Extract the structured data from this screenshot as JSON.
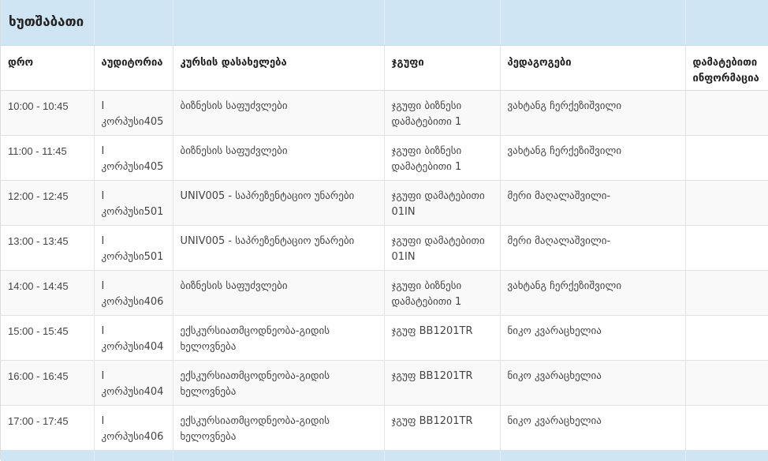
{
  "day_title": "ხუთშაბათი",
  "headers": {
    "time": "დრო",
    "room": "აუდიტორია",
    "course": "კურსის დასახელება",
    "group": "ჯგუფი",
    "teachers": "პედაგოგები",
    "extra": "დამატებითი ინფორმაცია"
  },
  "rows": [
    {
      "time": "10:00 - 10:45",
      "room_line1": "I",
      "room_line2": "კორპუსი405",
      "course": "ბიზნესის საფუძვლები",
      "group": "ჯგუფი ბიზნესი დამატებითი 1",
      "teacher": "ვახტანგ ჩერქეზიშვილი",
      "extra": ""
    },
    {
      "time": "11:00 - 11:45",
      "room_line1": "I",
      "room_line2": "კორპუსი405",
      "course": "ბიზნესის საფუძვლები",
      "group": "ჯგუფი ბიზნესი დამატებითი 1",
      "teacher": "ვახტანგ ჩერქეზიშვილი",
      "extra": ""
    },
    {
      "time": "12:00 - 12:45",
      "room_line1": "I",
      "room_line2": "კორპუსი501",
      "course": "UNIV005 - საპრეზენტაციო უნარები",
      "group": "ჯგუფი დამატებითი 01IN",
      "teacher": "მერი მაღალაშვილი-",
      "extra": ""
    },
    {
      "time": "13:00 - 13:45",
      "room_line1": "I",
      "room_line2": "კორპუსი501",
      "course": "UNIV005 - საპრეზენტაციო უნარები",
      "group": "ჯგუფი დამატებითი 01IN",
      "teacher": "მერი მაღალაშვილი-",
      "extra": ""
    },
    {
      "time": "14:00 - 14:45",
      "room_line1": "I",
      "room_line2": "კორპუსი406",
      "course": "ბიზნესის საფუძვლები",
      "group": "ჯგუფი ბიზნესი დამატებითი 1",
      "teacher": "ვახტანგ ჩერქეზიშვილი",
      "extra": ""
    },
    {
      "time": "15:00 - 15:45",
      "room_line1": "I",
      "room_line2": "კორპუსი404",
      "course": "ექსკურსიათმცოდნეობა-გიდის ხელოვნება",
      "group": "ჯგუფ BB1201TR",
      "teacher": "ნიკო კვარაცხელია",
      "extra": ""
    },
    {
      "time": "16:00 - 16:45",
      "room_line1": "I",
      "room_line2": "კორპუსი404",
      "course": "ექსკურსიათმცოდნეობა-გიდის ხელოვნება",
      "group": "ჯგუფ BB1201TR",
      "teacher": "ნიკო კვარაცხელია",
      "extra": ""
    },
    {
      "time": "17:00 - 17:45",
      "room_line1": "I",
      "room_line2": "კორპუსი406",
      "course": "ექსკურსიათმცოდნეობა-გიდის ხელოვნება",
      "group": "ჯგუფ BB1201TR",
      "teacher": "ნიკო კვარაცხელია",
      "extra": ""
    }
  ],
  "colors": {
    "day_header_bg": "#cfe5f3",
    "row_stripe": "#f9f9f9",
    "border": "#e2e2e2"
  }
}
